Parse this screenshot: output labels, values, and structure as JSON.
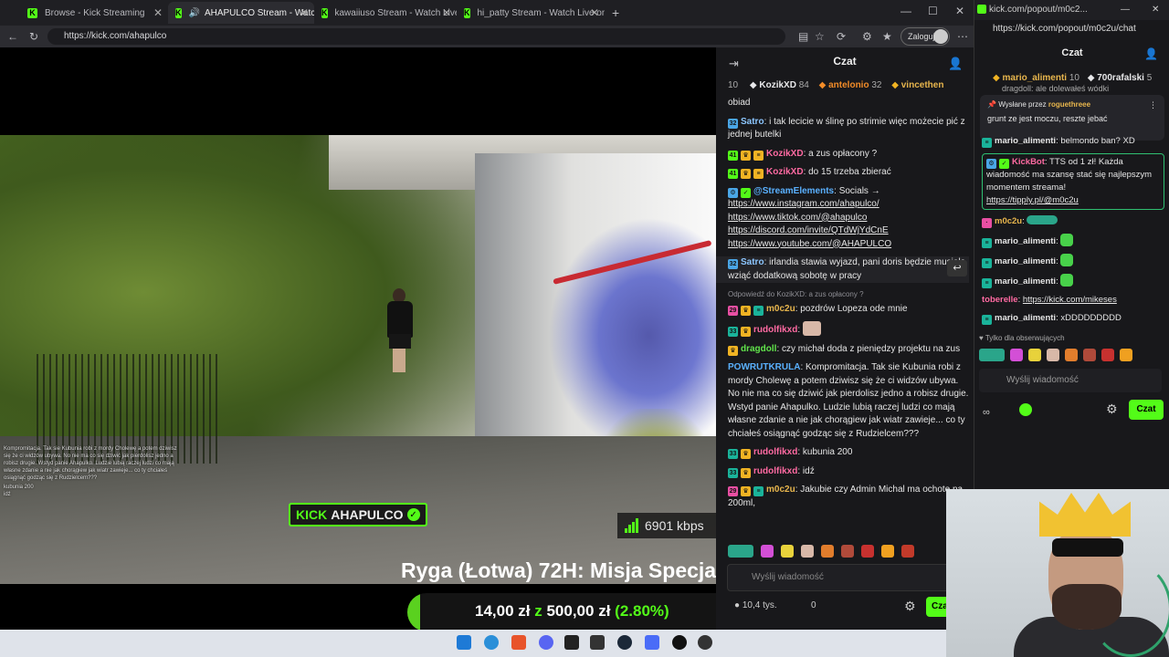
{
  "tabs": [
    {
      "label": "Browse - Kick Streaming"
    },
    {
      "label": "AHAPULCO Stream - Watch L"
    },
    {
      "label": "kawaiiuso Stream - Watch Live on"
    },
    {
      "label": "hi_patty Stream - Watch Live on"
    }
  ],
  "address": {
    "url": "https://kick.com/ahapulco",
    "login": "Zaloguj"
  },
  "video": {
    "overlay_chat": "Kompromitacja. Tak sie Kubunia robi z mordy Cholewę a potem dziwisz się że ci widzów ubywa. No nie ma co się dziwić jak pierdolisz jedno a robisz drugie. Wstyd panie Ahapulko. Ludzie lubią raczej ludzi co mają własne zdanie a nie jak chorągiew jak wiatr zawieje... co ty chciałeś osiągnąć godząc się z Rudzielcem???",
    "overlay_line2": "kubunia 200",
    "overlay_line3": "idź",
    "kick_label": "KICK",
    "channel_label": "AHAPULCO",
    "bitrate": "6901 kbps",
    "stream_title": "Ryga (Łotwa) 72H: Misja Specjalna",
    "goal_current": "14,00 zł",
    "goal_z": "z",
    "goal_total": "500,00 zł",
    "goal_pct": "(2.80%)",
    "goal_fraction": 0.028
  },
  "chat": {
    "title": "Czat",
    "leader_count": "10",
    "leaders": [
      {
        "name": "KozikXD",
        "count": "84"
      },
      {
        "name": "antelonio",
        "count": "32"
      },
      {
        "name": "vincethen",
        "count": ""
      }
    ],
    "messages": [
      {
        "badge": "",
        "user": "",
        "text": "obiad"
      },
      {
        "badge": "32",
        "user": "Satro",
        "text": "i tak lecicie w ślinę po strimie więc możecie pić z jednej butelki"
      },
      {
        "badge": "41",
        "user": "KozikXD",
        "text": "a zus opłacony ?"
      },
      {
        "badge": "41",
        "user": "KozikXD",
        "text": "do 15 trzeba zbierać"
      },
      {
        "badge": "",
        "user": "@StreamElements",
        "text": "Socials →"
      },
      {
        "badge": "32",
        "user": "Satro",
        "text": "irlandia stawia wyjazd, pani doris będzie musiała wziąć dodatkową sobotę w pracy"
      },
      {
        "badge": "",
        "user": "",
        "text": "Odpowiedź do KozikXD: a zus opłacony ?"
      },
      {
        "badge": "29",
        "user": "m0c2u",
        "text": "pozdrów Lopeza ode mnie"
      },
      {
        "badge": "33",
        "user": "rudolfikxd",
        "text": ""
      },
      {
        "badge": "",
        "user": "dragdoll",
        "text": "czy michał doda z pieniędzy projektu na zus"
      },
      {
        "badge": "",
        "user": "POWRUTKRULA",
        "text": "Kompromitacja. Tak sie Kubunia robi z mordy Cholewę a potem dziwisz się że ci widzów ubywa. No nie ma co się dziwić jak pierdolisz jedno a robisz drugie. Wstyd panie Ahapulko. Ludzie lubią raczej ludzi co mają własne zdanie a nie jak chorągiew jak wiatr zawieje... co ty chciałeś osiągnąć godząc się z Rudzielcem???"
      },
      {
        "badge": "33",
        "user": "rudolfikxd",
        "text": "kubunia 200"
      },
      {
        "badge": "33",
        "user": "rudolfikxd",
        "text": "idź"
      },
      {
        "badge": "29",
        "user": "m0c2u",
        "text": "Jakubie czy Admin Michal ma ochotę na 200ml,"
      }
    ],
    "links": [
      "https://www.instagram.com/ahapulco/",
      "https://www.tiktok.com/@ahapulco",
      "https://discord.com/invite/QTdWjYdCnE",
      "https://www.youtube.com/@AHAPULCO"
    ],
    "input_placeholder": "Wyślij wiadomość",
    "viewers": "10,4 tys.",
    "zero": "0",
    "send_label": "Czat"
  },
  "popout": {
    "titlebar": "kick.com/popout/m0c2...",
    "url": "https://kick.com/popout/m0c2u/chat",
    "title": "Czat",
    "leader1": "mario_alimenti",
    "leader1_count": "10",
    "leader2": "700rafalski",
    "leader2_count": "5",
    "pinned_by_label": "Wysłane przez",
    "pinned_by": "roguethreee",
    "pinned_text": "grunt ze jest moczu, reszte jebać",
    "partial_line": "dragdoll: ale dolewałeś wódki",
    "messages": [
      {
        "user": "mario_alimenti",
        "text": "belmondo ban? XD"
      },
      {
        "user": "KickBot",
        "text": "TTS od 1 zł! Każda wiadomość ma szansę stać się najlepszym momentem streama!"
      },
      {
        "user": "m0c2u",
        "text": ""
      },
      {
        "user": "mario_alimenti",
        "text": ""
      },
      {
        "user": "mario_alimenti",
        "text": ""
      },
      {
        "user": "mario_alimenti",
        "text": ""
      },
      {
        "user": "toberelle",
        "text": "https://kick.com/mikeses"
      },
      {
        "user": "mario_alimenti",
        "text": "xDDDDDDDDD"
      }
    ],
    "tts_link": "https://tipply.pl/@m0c2u",
    "follow_only": "Tylko dla obserwujących",
    "input_placeholder": "Wyślij wiadomość",
    "send_label": "Czat"
  }
}
